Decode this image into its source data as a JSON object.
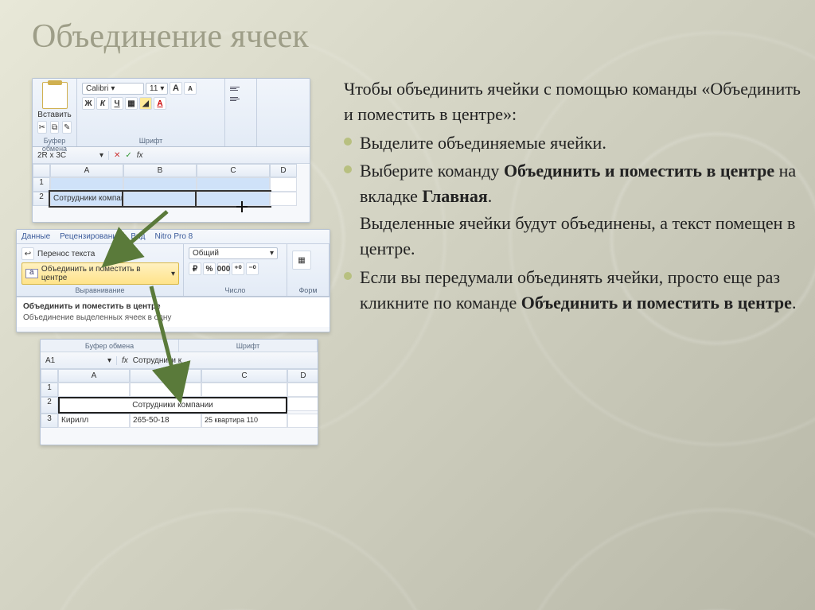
{
  "slide": {
    "title": "Объединение ячеек"
  },
  "text": {
    "intro": "Чтобы объединить ячейки с помощью команды «Объединить и поместить в центре»:",
    "b1": "Выделите объединяемые ячейки.",
    "b2_pre": "Выберите команду ",
    "b2_bold1": "Объединить и поместить в центре",
    "b2_mid": " на вкладке ",
    "b2_bold2": "Главная",
    "b2_end": ".",
    "after": "Выделенные ячейки будут объединены, а текст помещен в центре.",
    "b3_pre": "Если вы передумали объединять ячейки, просто еще раз кликните по команде ",
    "b3_bold": "Объединить и поместить в центре",
    "b3_end": "."
  },
  "excel": {
    "paste_label": "Вставить",
    "clipboard_label": "Буфер обмена",
    "font_label": "Шрифт",
    "align_label": "Выравнивание",
    "number_label": "Число",
    "font_name": "Calibri",
    "font_size": "11",
    "bold": "Ж",
    "italic": "К",
    "underline": "Ч",
    "grow": "A",
    "shrink": "A",
    "name_box1": "2R x 3C",
    "fx": "fx",
    "cols": {
      "A": "A",
      "B": "B",
      "C": "C",
      "D": "D"
    },
    "rows": {
      "1": "1",
      "2": "2",
      "3": "3"
    },
    "cell_a2": "Сотрудники компании",
    "tabs": {
      "data": "Данные",
      "review": "Рецензирование",
      "view": "Вид",
      "nitro": "Nitro Pro 8"
    },
    "wrap_text": "Перенос текста",
    "merge_center": "Объединить и поместить в центре",
    "number_format": "Общий",
    "num_percent": "%",
    "num_thousand": "000",
    "tooltip_title": "Объединить и поместить в центре",
    "tooltip_body": "Объединение выделенных ячеек в одну",
    "name_box3": "A1",
    "formula3": "Сотрудники к",
    "cell_a3": "Кирилл",
    "cell_b3": "265-50-18",
    "cell_c3": "25 квартира 110",
    "format_word": "Форм"
  }
}
